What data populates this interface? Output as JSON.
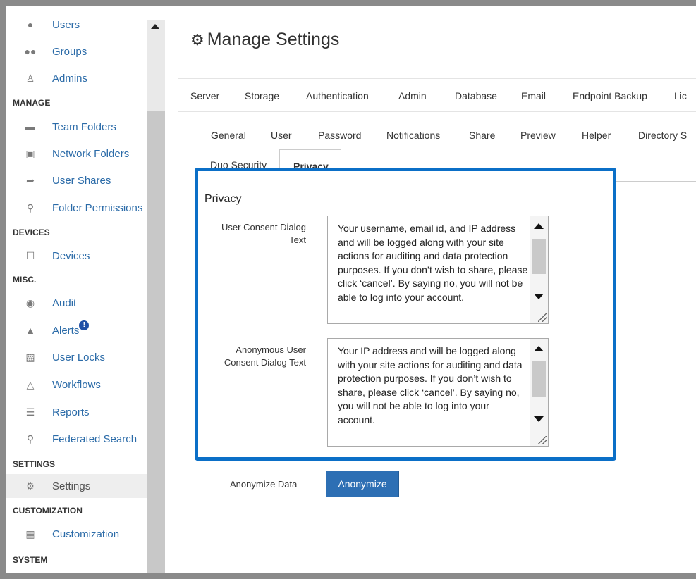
{
  "sidebar": {
    "items": [
      {
        "label": "Users",
        "icon": "users-icon"
      },
      {
        "label": "Groups",
        "icon": "groups-icon"
      },
      {
        "label": "Admins",
        "icon": "admins-icon"
      },
      {
        "label": "Team Folders",
        "icon": "folder-icon"
      },
      {
        "label": "Network Folders",
        "icon": "network-folder-icon"
      },
      {
        "label": "User Shares",
        "icon": "share-icon"
      },
      {
        "label": "Folder Permissions",
        "icon": "folder-permissions-icon"
      },
      {
        "label": "Devices",
        "icon": "devices-icon"
      },
      {
        "label": "Audit",
        "icon": "eye-icon"
      },
      {
        "label": "Alerts",
        "icon": "bell-icon"
      },
      {
        "label": "User Locks",
        "icon": "lock-icon"
      },
      {
        "label": "Workflows",
        "icon": "flask-icon"
      },
      {
        "label": "Reports",
        "icon": "list-icon"
      },
      {
        "label": "Federated Search",
        "icon": "search-icon"
      },
      {
        "label": "Settings",
        "icon": "gear-icon"
      },
      {
        "label": "Customization",
        "icon": "image-icon"
      }
    ],
    "headers": {
      "manage": "MANAGE",
      "devices": "DEVICES",
      "misc": "MISC.",
      "settings": "SETTINGS",
      "customization": "CUSTOMIZATION",
      "system": "SYSTEM"
    },
    "alerts_badge": "!"
  },
  "header": {
    "title": "Manage Settings"
  },
  "tabs_primary": [
    "Server",
    "Storage",
    "Authentication",
    "Admin",
    "Database",
    "Email",
    "Endpoint Backup",
    "Lic"
  ],
  "tabs_secondary": [
    "General",
    "User",
    "Password",
    "Notifications",
    "Share",
    "Preview",
    "Helper",
    "Directory S"
  ],
  "tabs_tertiary": [
    "Duo Security",
    "Privacy"
  ],
  "privacy": {
    "section_title": "Privacy",
    "consent_label_line1": "User Consent Dialog",
    "consent_label_line2": "Text",
    "consent_text": "Your username, email id, and IP address and will be logged along with your site actions for auditing and data protection purposes. If you don’t wish to share, please click ‘cancel’. By saying no, you will  not be able to log into your account.",
    "anon_consent_label_line1": "Anonymous User",
    "anon_consent_label_line2": "Consent Dialog Text",
    "anon_consent_text": "Your IP address and will be logged along with your site actions for auditing and data protection purposes. If you don’t wish to share, please click ‘cancel’. By saying no, you will  not be able to log into your account."
  },
  "anonymize": {
    "label": "Anonymize Data",
    "button": "Anonymize"
  },
  "colors": {
    "accent": "#0b6fc7",
    "link": "#2b6ba8",
    "button": "#2d6fb4"
  }
}
